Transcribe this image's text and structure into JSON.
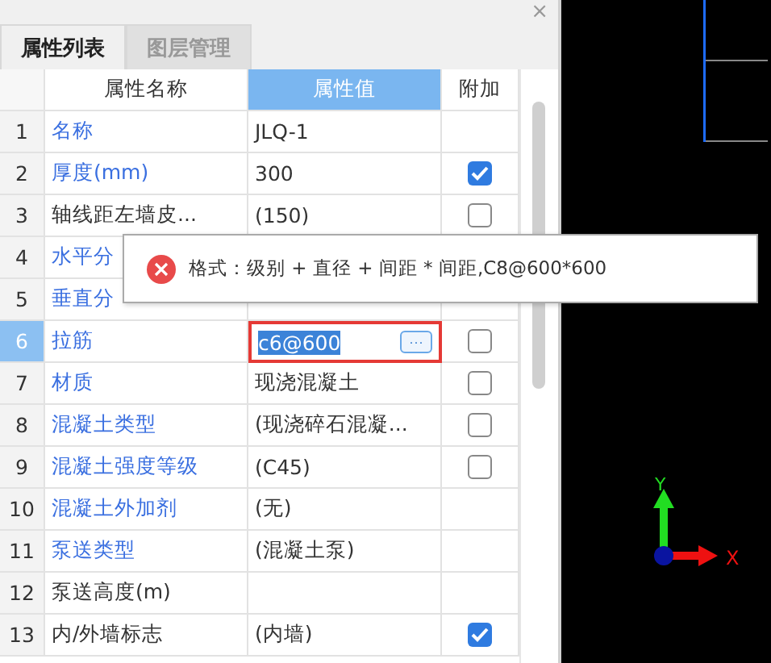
{
  "tabs": [
    {
      "label": "属性列表",
      "selected": true
    },
    {
      "label": "图层管理",
      "selected": false
    }
  ],
  "columns": [
    "属性名称",
    "属性值",
    "附加"
  ],
  "rows": [
    {
      "index": "1",
      "name": "名称",
      "kind": "public",
      "value": "JLQ-1",
      "selected": false
    },
    {
      "index": "2",
      "name": "厚度(mm)",
      "kind": "public",
      "value": "300",
      "checked": true,
      "selected": false
    },
    {
      "index": "3",
      "name": "轴线距左墙皮...",
      "kind": "private",
      "value": "(150)",
      "checked": false,
      "selected": false
    },
    {
      "index": "4",
      "name": "水平分",
      "kind": "public",
      "selected": false
    },
    {
      "index": "5",
      "name": "垂直分",
      "kind": "public",
      "selected": false
    },
    {
      "index": "6",
      "name": "拉筋",
      "kind": "public",
      "value": "c6@600",
      "checked": false,
      "selected": true
    },
    {
      "index": "7",
      "name": "材质",
      "kind": "public",
      "value": "现浇混凝土",
      "checked": false,
      "selected": false
    },
    {
      "index": "8",
      "name": "混凝土类型",
      "kind": "public",
      "value": "(现浇碎石混凝...",
      "checked": false,
      "selected": false
    },
    {
      "index": "9",
      "name": "混凝土强度等级",
      "kind": "public",
      "value": "(C45)",
      "checked": false,
      "selected": false
    },
    {
      "index": "10",
      "name": "混凝土外加剂",
      "kind": "public",
      "value": "(无)",
      "selected": false
    },
    {
      "index": "11",
      "name": "泵送类型",
      "kind": "public",
      "value": "(混凝土泵)",
      "selected": false
    },
    {
      "index": "12",
      "name": "泵送高度(m)",
      "kind": "private",
      "selected": false
    },
    {
      "index": "13",
      "name": "内/外墙标志",
      "kind": "private",
      "value": "(内墙)",
      "checked": true,
      "selected": false
    }
  ],
  "tooltip": {
    "text": "格式：级别 + 直径 + 间距 * 间距,C8@600*600"
  },
  "edit_button": "···",
  "close": "×",
  "axes": {
    "x": "X",
    "y": "Y"
  }
}
